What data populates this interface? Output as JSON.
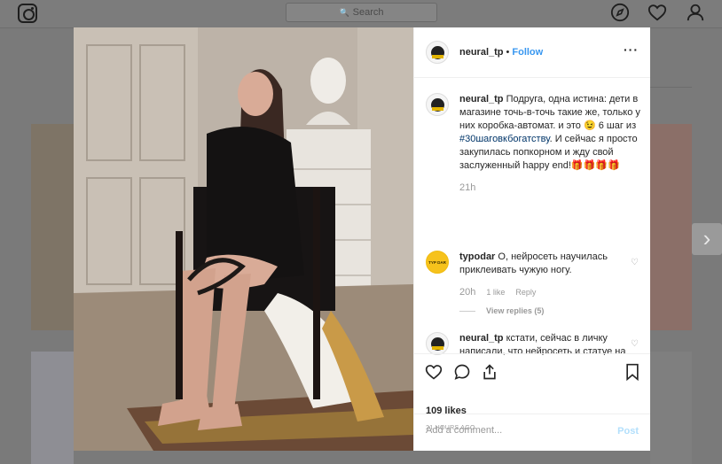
{
  "topbar": {
    "search_placeholder": "Search",
    "icons": [
      "instagram-logo-icon",
      "compass-icon",
      "heart-icon",
      "user-icon"
    ]
  },
  "post": {
    "username": "neural_tp",
    "follow_label": "Follow",
    "dot": "•",
    "comments": [
      {
        "username": "neural_tp",
        "text_before_tag": "Подруга, одна истина: дети в магазине точь-в-точь такие же, только у них коробка-автомат. и это 😉 6 шаг из ",
        "hashtag": "#30шаговкбогатству",
        "text_after_tag": ". И сейчас я просто закупилась попкорном и жду свой заслуженный happy end!🎁🎁🎁🎁",
        "time": "21h"
      },
      {
        "username": "typodar",
        "avatar_text": "TYP DAR",
        "text": "О, нейросеть научилась приклеивать чужую ногу.",
        "time": "20h",
        "likes": "1 like",
        "reply_label": "Reply",
        "view_replies": "View replies (5)"
      },
      {
        "username": "neural_tp",
        "text": "кстати, сейчас в личку написали, что нейросеть и статуе на заднем плане лицо"
      }
    ],
    "likes": "109 likes",
    "time_ago": "21 HOURS AGO",
    "add_comment_placeholder": "Add a comment...",
    "post_label": "Post"
  },
  "colors": {
    "link": "#3897f0",
    "post_disabled": "#b2dffc",
    "hashtag": "#003569",
    "overlay": "#7a7a7a"
  }
}
